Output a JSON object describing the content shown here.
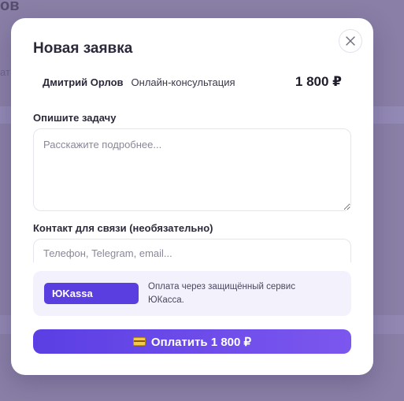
{
  "background": {
    "title_fragment": "ов",
    "side_fragment": "ат"
  },
  "modal": {
    "title": "Новая заявка",
    "close_icon": "close-icon",
    "summary": {
      "specialist": "Дмитрий Орлов",
      "service": "Онлайн-консультация",
      "price": "1 800 ₽"
    },
    "task_field": {
      "label": "Опишите задачу",
      "placeholder": "Расскажите подробнее...",
      "value": ""
    },
    "contact_field": {
      "label": "Контакт для связи (необязательно)",
      "placeholder": "Телефон, Telegram, email...",
      "value": ""
    },
    "payment": {
      "provider_badge": "ЮKassa",
      "note": "Оплата через защищённый сервис ЮКасса."
    },
    "pay_button": {
      "icon": "credit-card-icon",
      "label": "Оплатить 1 800 ₽"
    }
  },
  "colors": {
    "accent": "#5b3ee0",
    "overlay": "#8a7fa6",
    "payment_bg": "#f3f1fc"
  }
}
